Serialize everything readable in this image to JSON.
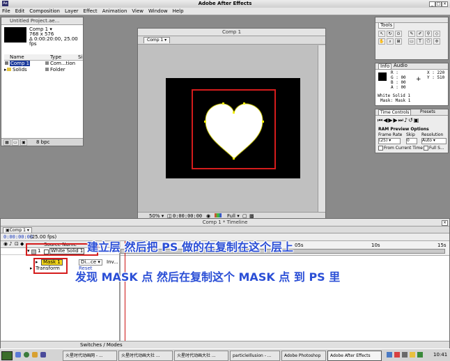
{
  "app_title": "Adobe After Effects",
  "menu": [
    "File",
    "Edit",
    "Composition",
    "Layer",
    "Effect",
    "Animation",
    "View",
    "Window",
    "Help"
  ],
  "project": {
    "title": "Untitled Project.ae...",
    "comp_name": "Comp 1 ▾",
    "dims": "768 x 576",
    "duration": "Δ 0:00:20:00, 25.00 fps",
    "headers": {
      "name": "Name",
      "type": "Type",
      "size": "Si"
    },
    "rows": [
      {
        "name": "Comp 1",
        "type": "Com...tion"
      },
      {
        "name": "Solids",
        "type": "Folder"
      }
    ],
    "bpc": "8 bpc"
  },
  "comp": {
    "window_title": "Comp 1",
    "tab": "Comp 1",
    "zoom": "50%",
    "timecode": "0:00:00:00",
    "res": "Full"
  },
  "tools": {
    "title": "Tools"
  },
  "info": {
    "tabs": [
      "Info",
      "Audio"
    ],
    "r": "R : ",
    "g": "G : 00",
    "b": "B : 00",
    "a": "A : 00",
    "x": "X : 220",
    "y": "Y : 510",
    "layer": "White Solid 1",
    "mask": "Mask: Mask 1"
  },
  "time_controls": {
    "tabs": [
      "Time Controls",
      "Presets"
    ],
    "ram_label": "RAM Preview Options",
    "frame_rate_label": "Frame Rate",
    "skip_label": "Skip",
    "resolution_label": "Resolution",
    "frame_rate": "(25)",
    "skip": "0",
    "resolution": "Auto",
    "from_current": "From Current Time",
    "full_screen": "Full S..."
  },
  "timeline": {
    "window_title": "Comp 1 * Timeline",
    "tab": "Comp 1",
    "timecode": "0:00:00:00",
    "fps": "(25.00 fps)",
    "source_name_header": "Source Name",
    "layer_num": "1",
    "layer_name": "White Solid 1",
    "mask_name": "Mask 1",
    "transform": "Transform",
    "mode": "Di...ce",
    "inv": "Inv...",
    "reset": "Reset",
    "switches": "Switches / Modes",
    "ruler_labels": [
      "05s",
      "10s",
      "15s"
    ]
  },
  "annotations": {
    "line1": "建立层 然后把 PS 做的在复制在这个层上",
    "line2": "发现 MASK 点  然后在复制这个 MASK 点 到 PS 里"
  },
  "taskbar": {
    "items": [
      "火星时代动画网 - ...",
      "火星时代动画大社 ...",
      "火星时代动画大社 ...",
      "particleIllusion - ...",
      "Adobe Photoshop",
      "Adobe After Effects"
    ],
    "clock": "10:41"
  }
}
